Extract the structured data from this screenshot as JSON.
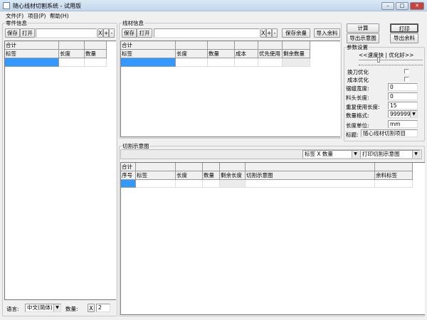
{
  "window": {
    "title": "随心线材切割系统 - 试用版",
    "minimize": "–",
    "maximize": "□",
    "close": "✕",
    "close_color": "#c8413a"
  },
  "menu": [
    "文件(F)",
    "项目(P)",
    "帮助(H)"
  ],
  "parts": {
    "group": "零件信息",
    "save": "保存",
    "open": "打开",
    "file_value": "",
    "x": "X",
    "plus": "+",
    "minus": "-",
    "total": "合计",
    "columns": [
      "标签",
      "长度",
      "数量"
    ]
  },
  "footer": {
    "language_label": "语言:",
    "language_value": "中文(简体)",
    "quantity_label": "数量:",
    "x": "X",
    "quantity_value": "2"
  },
  "stock": {
    "group": "线材信息",
    "save": "保存",
    "open": "打开",
    "file_value": "",
    "x": "X",
    "plus": "+",
    "minus": "-",
    "save_remain": "保存余量",
    "import_remain": "导入余料",
    "total": "合计",
    "columns": [
      "标签",
      "长度",
      "数量",
      "成本",
      "优先使用",
      "剩余数量"
    ]
  },
  "actions": {
    "calculate": "计算",
    "print": "打印",
    "export_diagram": "导出示意图",
    "export_remain": "导出余料"
  },
  "params": {
    "group": "参数设置",
    "slider_label": "<<速度快 | 优化好>>",
    "slider_position": 0.3,
    "knife_opt": "换刀优化",
    "cost_opt": "成本优化",
    "knife_checked": false,
    "cost_checked": false,
    "kerf_label": "锯缝宽度:",
    "kerf_value": "0",
    "head_label": "料头长度:",
    "head_value": "0",
    "reuse_label": "重复使用长度:",
    "reuse_value": "15",
    "qty_format_label": "数量格式:",
    "qty_format_value": "999999",
    "unit_label": "长度单位:",
    "unit_value": "mm",
    "title_label": "标题:",
    "title_value": "随心线材切割项目"
  },
  "diagram": {
    "group": "切割示意图",
    "label_select": "标签 X 数量",
    "print_select": "打印切割示意图",
    "total": "合计",
    "columns": [
      "序号",
      "标签",
      "长度",
      "数量",
      "剩余长度",
      "切割示意图",
      "余料标签"
    ]
  }
}
